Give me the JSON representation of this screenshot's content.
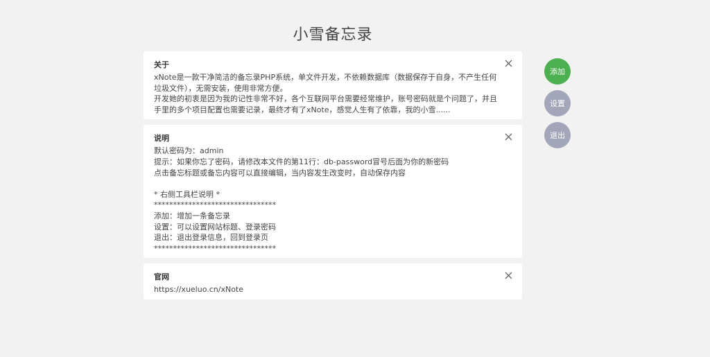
{
  "page": {
    "title": "小雪备忘录"
  },
  "notes": [
    {
      "title": "关于",
      "content": "xNote是一款干净简洁的备忘录PHP系统，单文件开发，不依赖数据库（数据保存于自身，不产生任何垃圾文件），无需安装，使用非常方便。\n开发她的初衷是因为我的记性非常不好，各个互联网平台需要经常维护，账号密码就是个问题了，并且手里的多个项目配置也需要记录，最终才有了xNote，感觉人生有了依靠，我的小雪......"
    },
    {
      "title": "说明",
      "content": "默认密码为：admin\n提示：如果你忘了密码，请修改本文件的第11行：db-password冒号后面为你的新密码\n点击备忘标题或备忘内容可以直接编辑，当内容发生改变时，自动保存内容\n\n* 右侧工具栏说明 *\n********************************\n添加：增加一条备忘录\n设置：可以设置网站标题、登录密码\n退出：退出登录信息，回到登录页\n********************************"
    },
    {
      "title": "官网",
      "content": "https://xueluo.cn/xNote"
    }
  ],
  "toolbar": {
    "add_label": "添加",
    "settings_label": "设置",
    "logout_label": "退出"
  },
  "colors": {
    "background": "#f2f2f2",
    "add_button": "#4caf50",
    "gray_button": "#a3a6b8"
  },
  "icons": {
    "close": "close-icon"
  }
}
